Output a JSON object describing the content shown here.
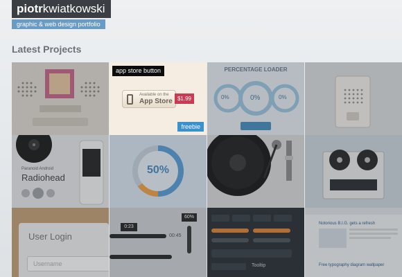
{
  "header": {
    "logo_bold": "piotr",
    "logo_rest": "kwiatkowski",
    "tagline": "graphic & web design portfolio"
  },
  "section_title": "Latest Projects",
  "tiles": {
    "app_store": {
      "hover_label": "app store button",
      "badge": "freebie",
      "button_small": "Available on the",
      "button_big": "App Store",
      "price": "$1.99"
    },
    "loader": {
      "title": "PERCENTAGE LOADER",
      "val_left": "0%",
      "val_mid": "0%",
      "val_right": "0%"
    },
    "player": {
      "subtitle": "Paranoid Android",
      "artist": "Radiohead"
    },
    "progress": {
      "value": "50%"
    },
    "login": {
      "title": "User Login",
      "placeholder": "Username"
    },
    "media": {
      "tooltip": "0:23",
      "time": "00:45",
      "volume": "60%"
    },
    "blog": {
      "post1": "Notorious B.I.G. gets a refresh",
      "post2": "Free typography diagram wallpaper"
    },
    "dash": {
      "tooltip": "Tooltip"
    }
  }
}
